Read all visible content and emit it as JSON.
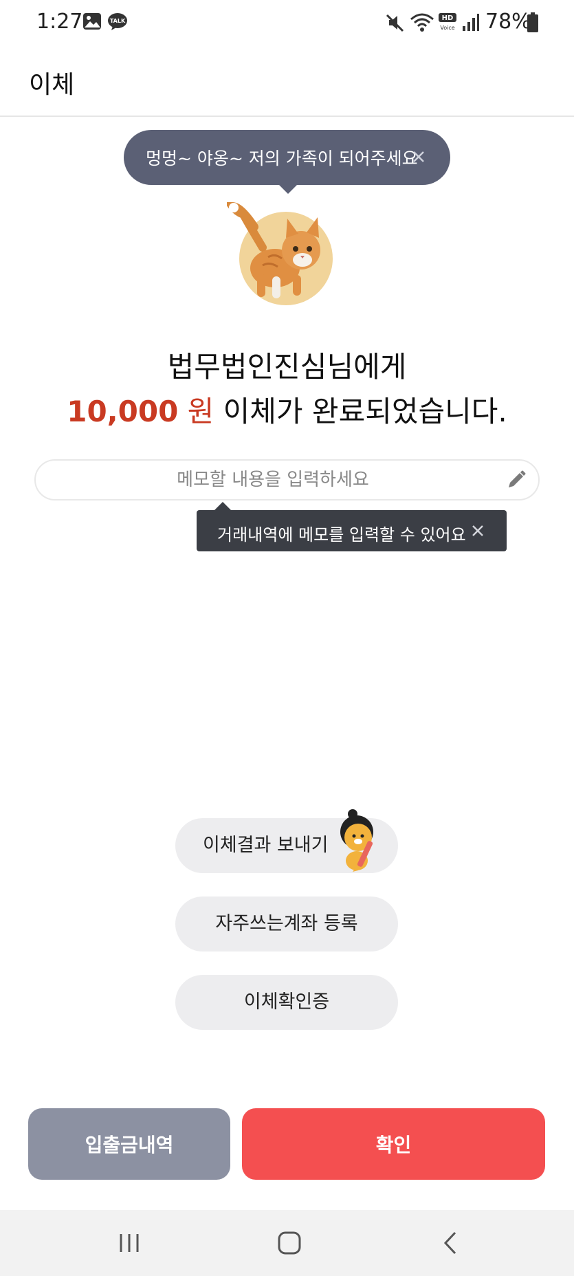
{
  "status_bar": {
    "time": "1:27",
    "talk_badge": "TALK",
    "hd_badge_top": "HD",
    "hd_badge_bottom": "Voice",
    "battery": "78%"
  },
  "header": {
    "title": "이체"
  },
  "promo": {
    "text": "멍멍~ 야옹~ 저의 가족이 되어주세요"
  },
  "result": {
    "line1": "법무법인진심님에게",
    "amount": "10,000",
    "currency": "원",
    "line2_suffix": "이체가 완료되었습니다."
  },
  "memo": {
    "placeholder": "메모할 내용을 입력하세요",
    "value": "",
    "tooltip": "거래내역에 메모를 입력할 수 있어요"
  },
  "actions": {
    "send_result": "이체결과 보내기",
    "register_favorite": "자주쓰는계좌 등록",
    "transfer_certificate": "이체확인증"
  },
  "bottom": {
    "history": "입출금내역",
    "confirm": "확인"
  },
  "colors": {
    "accent_red": "#f44f50",
    "amount_red": "#c93a22",
    "bubble": "#5b6075",
    "tooltip": "#3b3e45",
    "secondary_button": "#8c91a2"
  }
}
